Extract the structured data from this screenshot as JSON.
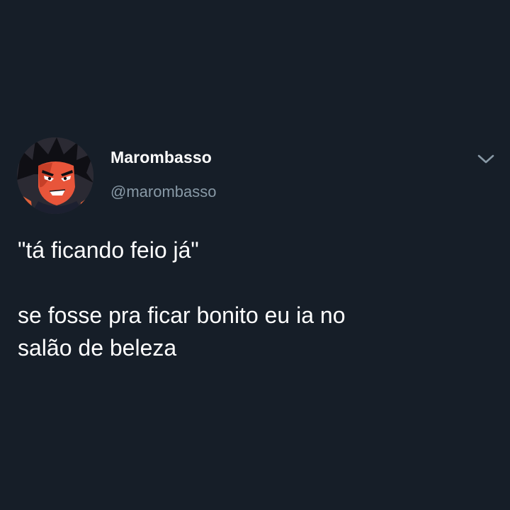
{
  "tweet": {
    "display_name": "Marombasso",
    "handle": "@marombasso",
    "lines": [
      "\"tá ficando feio já\"",
      "se fosse pra ficar bonito eu ia no",
      "salão de beleza"
    ],
    "avatar_icon": "anime-character-avatar",
    "menu_icon": "chevron-down-icon"
  },
  "colors": {
    "background": "#161e28",
    "name": "#ffffff",
    "handle": "#8899a6",
    "text": "#ffffff"
  }
}
